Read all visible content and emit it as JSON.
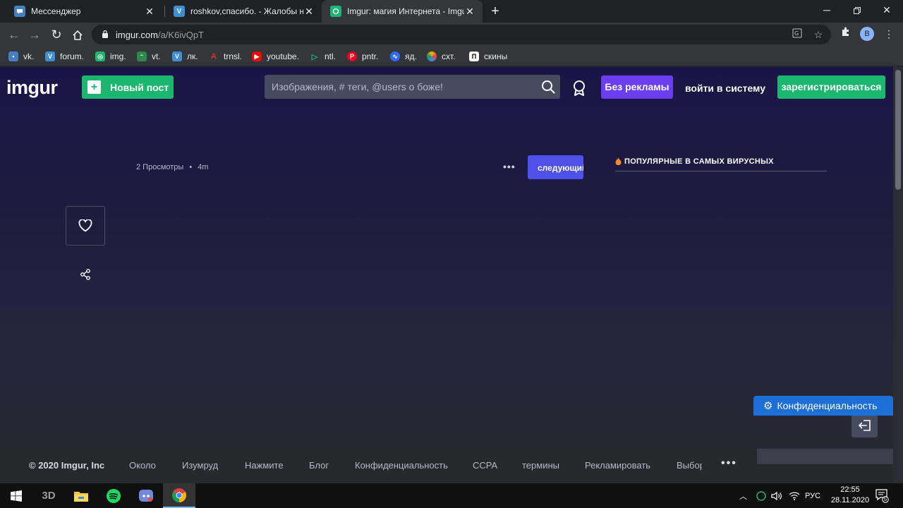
{
  "browser": {
    "tabs": [
      {
        "title": "Мессенджер",
        "favicon": "vk-messenger-icon",
        "active": false
      },
      {
        "title": "roshkov,спасибо. - Жалобы на п",
        "favicon": "forum-icon",
        "active": false
      },
      {
        "title": "Imgur: магия Интернета - Imgur",
        "favicon": "imgur-icon",
        "active": true
      }
    ],
    "new_tab_label": "+",
    "address": {
      "host": "imgur.com",
      "path": "/a/K6ivQpT"
    },
    "profile_initial": "B",
    "bookmarks": [
      {
        "label": "vk.",
        "icon": "vk-icon",
        "color": "#4680c2"
      },
      {
        "label": "forum.",
        "icon": "forum-icon",
        "color": "#3f8fd2"
      },
      {
        "label": "img.",
        "icon": "imgur-icon",
        "color": "#1bb76e"
      },
      {
        "label": "vt.",
        "icon": "cat-icon",
        "color": "#2c8a4a"
      },
      {
        "label": "лк.",
        "icon": "forum-icon",
        "color": "#3f8fd2"
      },
      {
        "label": "trnsl.",
        "icon": "translate-icon",
        "color": "#d93025"
      },
      {
        "label": "youtube.",
        "icon": "youtube-icon",
        "color": "#ff0000"
      },
      {
        "label": "ntl.",
        "icon": "play-icon",
        "color": "#1bb76e"
      },
      {
        "label": "pntr.",
        "icon": "pinterest-icon",
        "color": "#e60023"
      },
      {
        "label": "яд.",
        "icon": "yandex-disk-icon",
        "color": "#2f6cf5"
      },
      {
        "label": "схт.",
        "icon": "color-wheel-icon",
        "color": "#f4b400"
      },
      {
        "label": "скины",
        "icon": "skins-icon",
        "color": "#ffffff"
      }
    ]
  },
  "header": {
    "logo": "imgur",
    "new_post": "Новый пост",
    "search_placeholder": "Изображения, # теги, @users о боже!",
    "no_ads": "Без рекламы",
    "login": "войти в систему",
    "register": "зарегистрироваться"
  },
  "post": {
    "views": "2 Просмотры",
    "separator": "•",
    "age": "4m",
    "more": "•••",
    "next": "следующий"
  },
  "sidebar": {
    "popular_title": "ПОПУЛЯРНЫЕ В САМЫХ ВИРУСНЫХ"
  },
  "footer": {
    "links": [
      "© 2020 Imgur, Inc",
      "Около",
      "Изумруд",
      "Нажмите",
      "Блог",
      "Конфиденциальность",
      "CCPA",
      "термины",
      "Рекламировать",
      "Выбор"
    ],
    "more": "•••",
    "privacy_button": "Конфиденциальность"
  },
  "taskbar": {
    "apps": [
      {
        "name": "windows-start-icon"
      },
      {
        "name": "3d-viewer-icon"
      },
      {
        "name": "file-explorer-icon"
      },
      {
        "name": "spotify-icon"
      },
      {
        "name": "discord-icon"
      },
      {
        "name": "chrome-icon",
        "active": true
      }
    ],
    "lang": "РУС",
    "time": "22:55",
    "date": "28.11.2020",
    "notifications": "5"
  },
  "colors": {
    "imgur_green": "#1bb76e",
    "no_ads_purple": "#6b3df0",
    "next_blue": "#4f51eb",
    "privacy_blue": "#1c6fd6"
  }
}
